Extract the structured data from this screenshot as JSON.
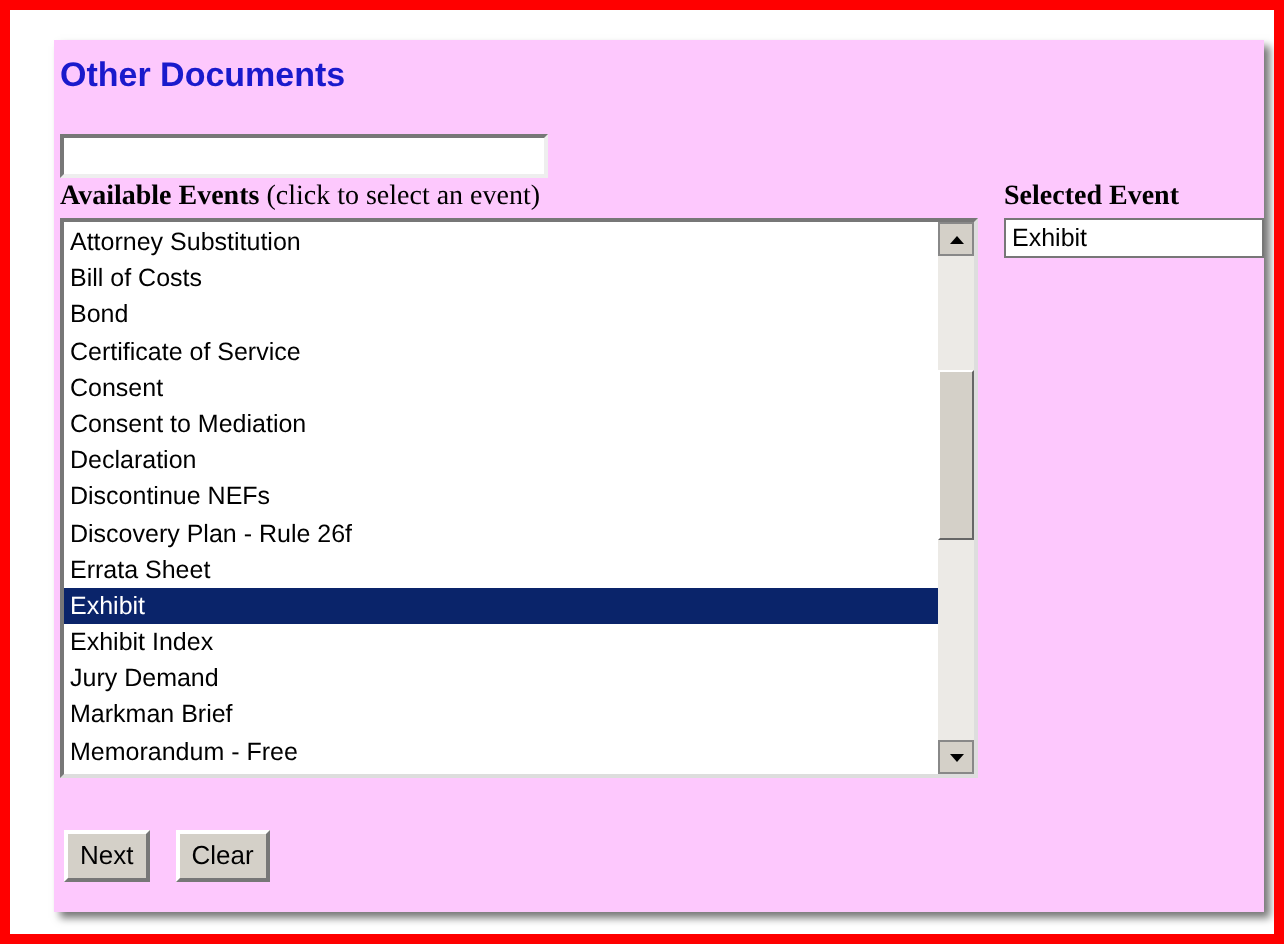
{
  "title": "Other Documents",
  "available_events": {
    "label": "Available Events",
    "hint": "(click to select an event)",
    "items": [
      {
        "label": "Attorney Substitution",
        "selected": false
      },
      {
        "label": "Bill of Costs",
        "selected": false
      },
      {
        "label": "Bond",
        "selected": false
      },
      {
        "label": "Certificate of Service",
        "selected": false
      },
      {
        "label": "Consent",
        "selected": false
      },
      {
        "label": "Consent to Mediation",
        "selected": false
      },
      {
        "label": "Declaration",
        "selected": false
      },
      {
        "label": "Discontinue NEFs",
        "selected": false
      },
      {
        "label": "Discovery Plan - Rule 26f",
        "selected": false
      },
      {
        "label": "Errata Sheet",
        "selected": false
      },
      {
        "label": "Exhibit",
        "selected": true
      },
      {
        "label": "Exhibit Index",
        "selected": false
      },
      {
        "label": "Jury Demand",
        "selected": false
      },
      {
        "label": "Markman Brief",
        "selected": false
      },
      {
        "label": "Memorandum - Free",
        "selected": false
      }
    ]
  },
  "selected_event": {
    "label": "Selected Event",
    "value": "Exhibit"
  },
  "buttons": [
    "Next",
    "Clear"
  ]
}
